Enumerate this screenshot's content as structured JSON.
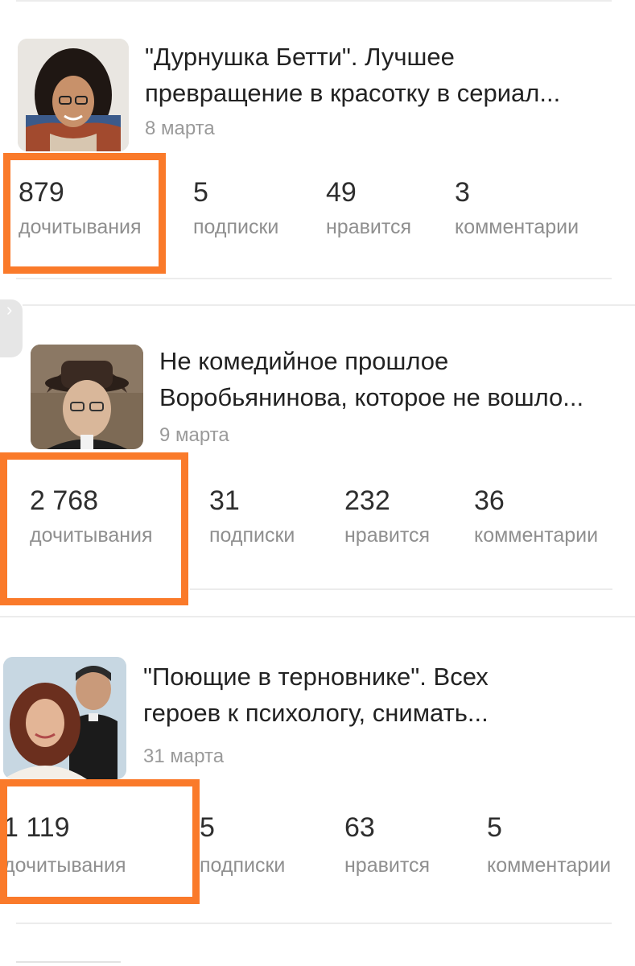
{
  "articles": [
    {
      "title_line1": "\"Дурнушка Бетти\". Лучшее",
      "title_line2": "превращение в красотку в сериал...",
      "date": "8 марта",
      "stats": [
        {
          "value": "879",
          "label": "дочитывания"
        },
        {
          "value": "5",
          "label": "подписки"
        },
        {
          "value": "49",
          "label": "нравится"
        },
        {
          "value": "3",
          "label": "комментарии"
        }
      ]
    },
    {
      "title_line1": "Не комедийное прошлое",
      "title_line2": "Воробьянинова, которое не вошло...",
      "date": "9 марта",
      "stats": [
        {
          "value": "2 768",
          "label": "дочитывания"
        },
        {
          "value": "31",
          "label": "подписки"
        },
        {
          "value": "232",
          "label": "нравится"
        },
        {
          "value": "36",
          "label": "комментарии"
        }
      ]
    },
    {
      "title_line1": "\"Поющие в терновнике\". Всех",
      "title_line2": "героев к психологу, снимать...",
      "date": "31 марта",
      "stats": [
        {
          "value": "1 119",
          "label": "дочитывания"
        },
        {
          "value": "5",
          "label": "подписки"
        },
        {
          "value": "63",
          "label": "нравится"
        },
        {
          "value": "5",
          "label": "комментарии"
        }
      ]
    }
  ],
  "side_tab_icon": "chevron-right-icon",
  "colors": {
    "highlight": "#fa7a2a",
    "divider": "#ececec",
    "date_text": "#9a9a9a",
    "label_text": "#8f8f8f"
  }
}
